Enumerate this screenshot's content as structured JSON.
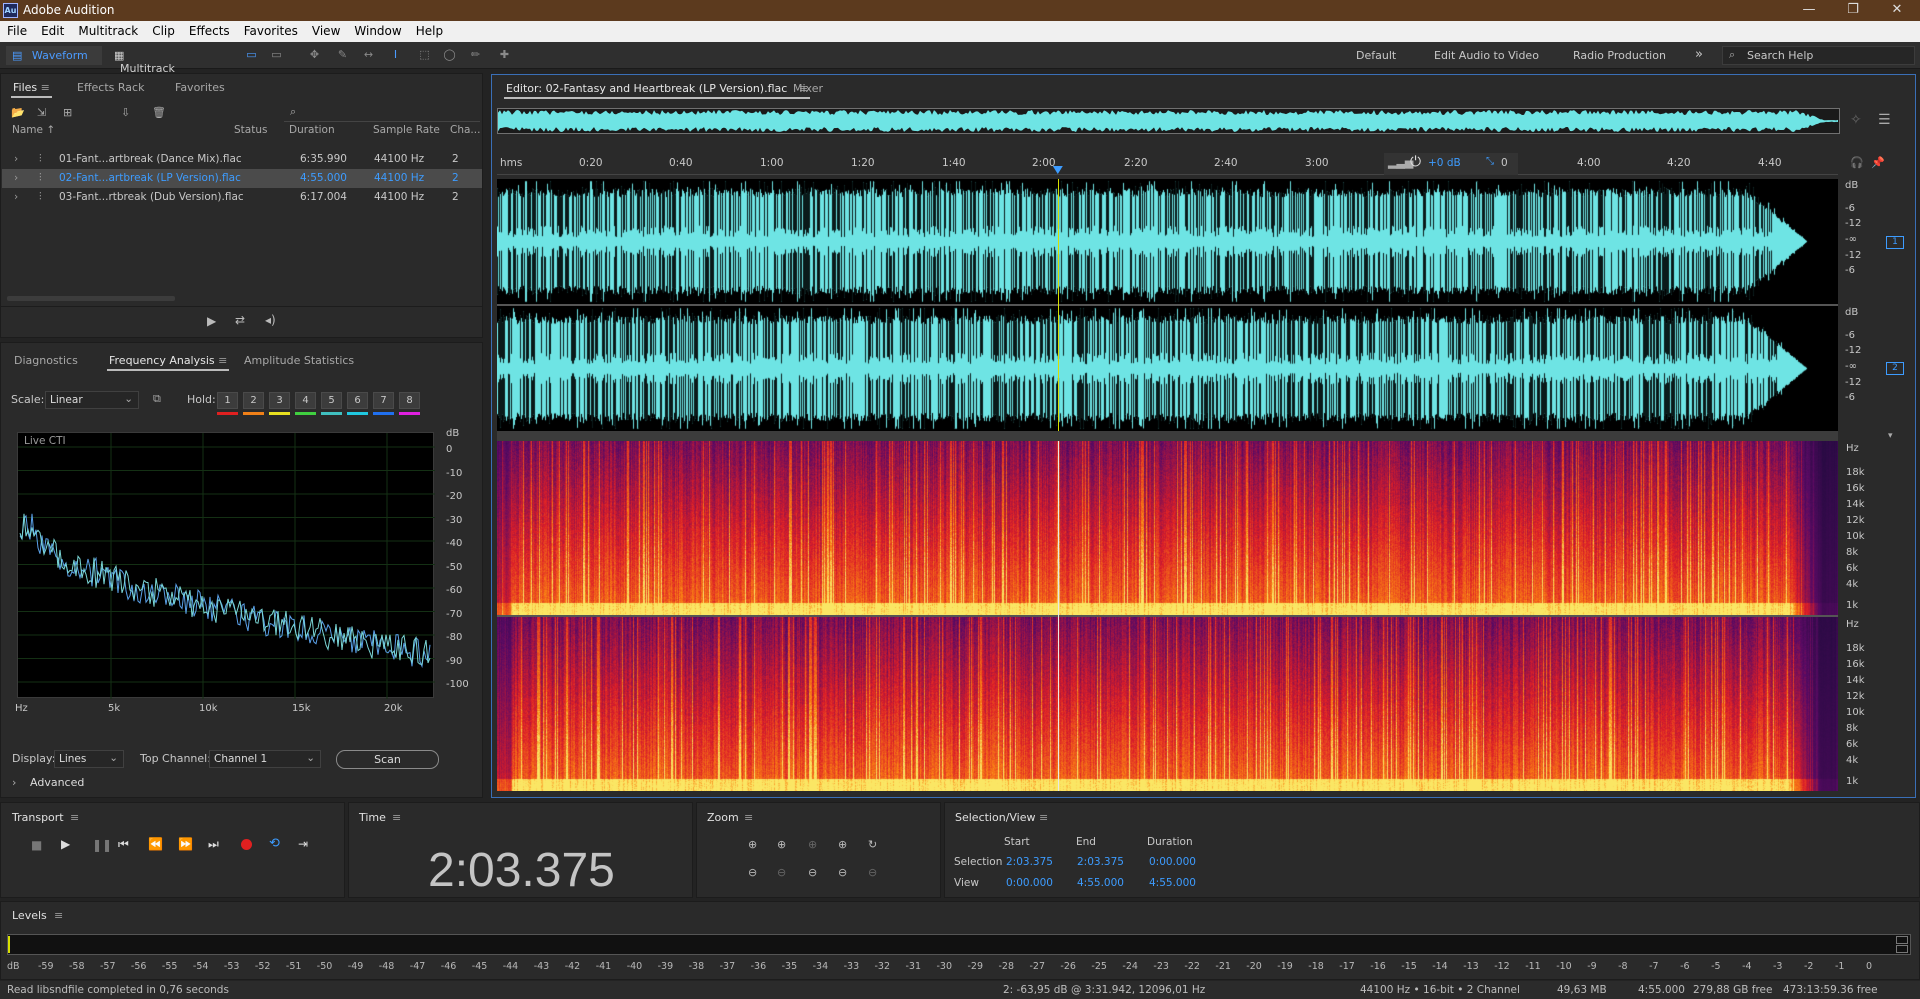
{
  "window": {
    "title": "Adobe Audition",
    "app_icon": "Au",
    "controls": [
      "—",
      "❐",
      "✕"
    ]
  },
  "menu": [
    "File",
    "Edit",
    "Multitrack",
    "Clip",
    "Effects",
    "Favorites",
    "View",
    "Window",
    "Help"
  ],
  "toolbar": {
    "waveform_label": "Waveform",
    "multitrack_label": "Multitrack",
    "workspaces": [
      "Default",
      "Edit Audio to Video",
      "Radio Production"
    ],
    "search_placeholder": "Search Help",
    "more": "»"
  },
  "files_panel": {
    "tabs": [
      "Files",
      "Effects Rack",
      "Favorites"
    ],
    "columns": [
      "Name",
      "Status",
      "Duration",
      "Sample Rate",
      "Cha..."
    ],
    "rows": [
      {
        "name": "01-Fant...artbreak (Dance Mix).flac",
        "duration": "6:35.990",
        "rate": "44100 Hz",
        "channels": "2"
      },
      {
        "name": "02-Fant...artbreak (LP Version).flac",
        "duration": "4:55.000",
        "rate": "44100 Hz",
        "channels": "2",
        "selected": true
      },
      {
        "name": "03-Fant...rtbreak (Dub Version).flac",
        "duration": "6:17.004",
        "rate": "44100 Hz",
        "channels": "2"
      }
    ]
  },
  "analysis_panel": {
    "tabs": [
      "Diagnostics",
      "Frequency Analysis",
      "Amplitude Statistics"
    ],
    "scale_label": "Scale:",
    "scale_value": "Linear",
    "hold_label": "Hold:",
    "hold_buttons": [
      "1",
      "2",
      "3",
      "4",
      "5",
      "6",
      "7",
      "8"
    ],
    "hold_colors": [
      "#e02020",
      "#f08018",
      "#e8e020",
      "#40d040",
      "#40c0c0",
      "#20c8e0",
      "#2070f0",
      "#e020e0"
    ],
    "plot_label": "Live CTI",
    "db_axis": [
      "dB",
      "0",
      "-10",
      "-20",
      "-30",
      "-40",
      "-50",
      "-60",
      "-70",
      "-80",
      "-90",
      "-100"
    ],
    "hz_axis": [
      "Hz",
      "5k",
      "10k",
      "15k",
      "20k"
    ],
    "display_label": "Display:",
    "display_value": "Lines",
    "top_channel_label": "Top Channel:",
    "top_channel_value": "Channel 1",
    "scan_label": "Scan",
    "advanced_label": "Advanced"
  },
  "editor": {
    "tab_label": "Editor: 02-Fantasy and Heartbreak (LP Version).flac",
    "mixer_label": "Mixer",
    "ruler": [
      "hms",
      "0:20",
      "0:40",
      "1:00",
      "1:20",
      "1:40",
      "2:00",
      "2:20",
      "2:40",
      "3:00",
      "4:00",
      "4:20",
      "4:40"
    ],
    "gain_label": "+0 dB",
    "pan_value": "0",
    "ch1_db": [
      "dB",
      "-6",
      "-12",
      "-∞",
      "-12",
      "-6"
    ],
    "ch2_db": [
      "dB",
      "-6",
      "-12",
      "-∞",
      "-12",
      "-6"
    ],
    "channel_badges": [
      "1",
      "2"
    ],
    "spec1_hz": [
      "Hz",
      "18k",
      "16k",
      "14k",
      "12k",
      "10k",
      "8k",
      "6k",
      "4k",
      "1k"
    ],
    "spec2_hz": [
      "Hz",
      "18k",
      "16k",
      "14k",
      "12k",
      "10k",
      "8k",
      "6k",
      "4k",
      "1k"
    ],
    "playhead_fraction": 0.4182,
    "waveform_color": "#6ee4e4"
  },
  "transport": {
    "title": "Transport"
  },
  "time_panel": {
    "title": "Time",
    "value": "2:03.375"
  },
  "zoom_panel": {
    "title": "Zoom"
  },
  "selection_view": {
    "title": "Selection/View",
    "headers": [
      "Start",
      "End",
      "Duration"
    ],
    "selection_label": "Selection",
    "view_label": "View",
    "selection": [
      "2:03.375",
      "2:03.375",
      "0:00.000"
    ],
    "view": [
      "0:00.000",
      "4:55.000",
      "4:55.000"
    ]
  },
  "levels": {
    "title": "Levels",
    "scale": [
      "dB",
      "-59",
      "-58",
      "-57",
      "-56",
      "-55",
      "-54",
      "-53",
      "-52",
      "-51",
      "-50",
      "-49",
      "-48",
      "-47",
      "-46",
      "-45",
      "-44",
      "-43",
      "-42",
      "-41",
      "-40",
      "-39",
      "-38",
      "-37",
      "-36",
      "-35",
      "-34",
      "-33",
      "-32",
      "-31",
      "-30",
      "-29",
      "-28",
      "-27",
      "-26",
      "-25",
      "-24",
      "-23",
      "-22",
      "-21",
      "-20",
      "-19",
      "-18",
      "-17",
      "-16",
      "-15",
      "-14",
      "-13",
      "-12",
      "-11",
      "-10",
      "-9",
      "-8",
      "-7",
      "-6",
      "-5",
      "-4",
      "-3",
      "-2",
      "-1",
      "0"
    ]
  },
  "status": {
    "message": "Read libsndfile completed in 0,76 seconds",
    "cursor": "2: -63,95 dB @ 3:31.942, 12096,01 Hz",
    "format": "44100 Hz • 16-bit • 2 Channel",
    "size": "49,63 MB",
    "duration": "4:55.000",
    "free": "279,88 GB free",
    "free_time": "473:13:59.36 free"
  }
}
